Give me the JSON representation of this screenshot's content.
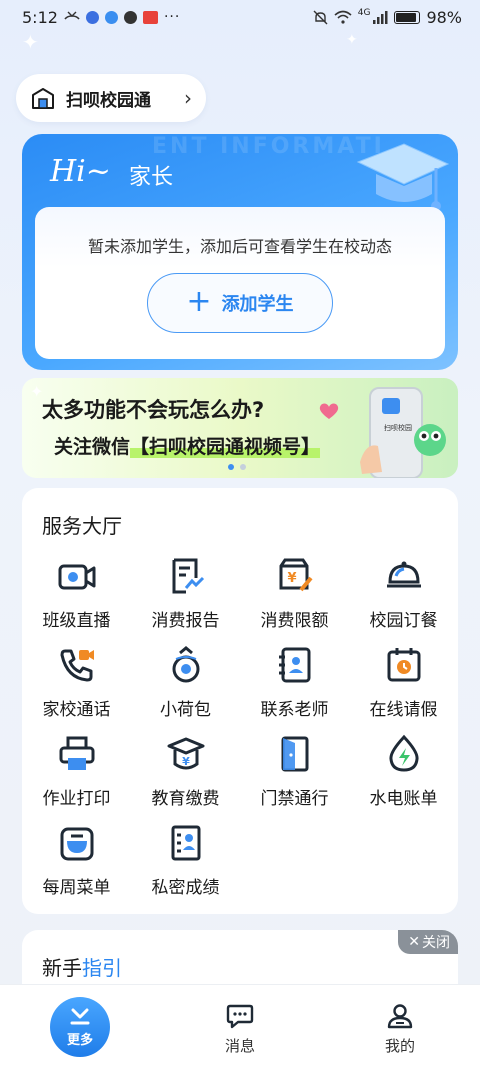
{
  "status_bar": {
    "time": "5:12",
    "battery": "98%",
    "network": "4G"
  },
  "header": {
    "school_label": "扫呗校园通"
  },
  "hero": {
    "greeting": "Hi~",
    "role": "家长",
    "watermark": "ENT INFORMATI",
    "message": "暂未添加学生，添加后可查看学生在校动态",
    "add_button": "添加学生"
  },
  "banner": {
    "line1": "太多功能不会玩怎么办?",
    "line2_prefix": "关注微信",
    "line2_highlight": "【扫呗校园通视频号】",
    "phone_badge": "扫呗校园",
    "page_count": 3,
    "active_page": 0
  },
  "services": {
    "title": "服务大厅",
    "items": [
      {
        "label": "班级直播",
        "icon": "video-camera-icon"
      },
      {
        "label": "消费报告",
        "icon": "report-chart-icon"
      },
      {
        "label": "消费限额",
        "icon": "wallet-limit-icon"
      },
      {
        "label": "校园订餐",
        "icon": "food-cloche-icon"
      },
      {
        "label": "家校通话",
        "icon": "phone-call-icon"
      },
      {
        "label": "小荷包",
        "icon": "money-pouch-icon"
      },
      {
        "label": "联系老师",
        "icon": "contact-card-icon"
      },
      {
        "label": "在线请假",
        "icon": "calendar-clock-icon"
      },
      {
        "label": "作业打印",
        "icon": "printer-icon"
      },
      {
        "label": "教育缴费",
        "icon": "mortarboard-fee-icon"
      },
      {
        "label": "门禁通行",
        "icon": "door-icon"
      },
      {
        "label": "水电账单",
        "icon": "water-drop-icon"
      },
      {
        "label": "每周菜单",
        "icon": "menu-bowl-icon"
      },
      {
        "label": "私密成绩",
        "icon": "private-score-icon"
      }
    ]
  },
  "guide": {
    "title_prefix": "新手",
    "title_accent": "指引",
    "close_label": "关闭"
  },
  "bottom_nav": {
    "more": "更多",
    "messages": "消息",
    "mine": "我的"
  },
  "colors": {
    "accent": "#2b86f0",
    "icon_orange": "#f08a24",
    "icon_dark": "#1f2a36"
  }
}
